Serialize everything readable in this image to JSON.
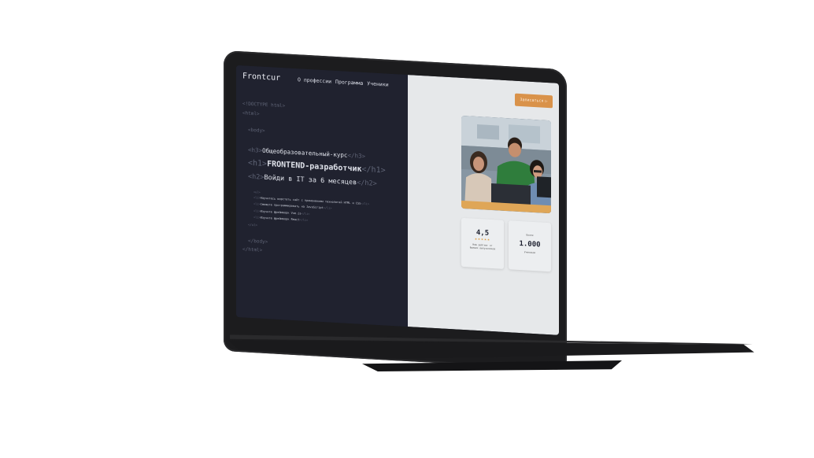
{
  "header": {
    "logo": "Frontcur",
    "nav": [
      "О профессии",
      "Программа",
      "Ученики"
    ]
  },
  "code": {
    "doctype": "<!DOCTYPE html>",
    "html_open": "<html>",
    "body_open": "<body>",
    "h3_open": "<h3>",
    "h3_text": "Общеобразовательный-курс",
    "h3_close": "</h3>",
    "h1_open": "<h1>",
    "h1_text": "FRONTEND-разработчик",
    "h1_close": "</h1>",
    "h2_open": "<h2>",
    "h2_text": "Войди в IT за 6 месяцев",
    "h2_close": "</h2>",
    "ul_open": "<ul>",
    "li_open": "<li>",
    "li_close": "</li>",
    "list_items": [
      "Научитесь верстать сайт с применением технологий HTML и CSS",
      "Сможете программировать на JavaScript",
      "Изучите фреймворк Vue.js",
      "Изучите фреймворк React"
    ],
    "ul_close": "</ul>",
    "body_close": "</body>",
    "html_close": "</html>"
  },
  "hero": {
    "signup_label": "Записаться",
    "signup_arrow": "▷"
  },
  "stats": {
    "rating_value": "4,5",
    "rating_stars": "★★★★★",
    "rating_caption": "Наш рейтинг от бывших выпускников",
    "students_top": "Более",
    "students_value": "1.000",
    "students_caption": "Учеников"
  },
  "colors": {
    "accent": "#d9924a",
    "code_bg": "#20222f",
    "panel_bg": "#e6e8ea"
  }
}
